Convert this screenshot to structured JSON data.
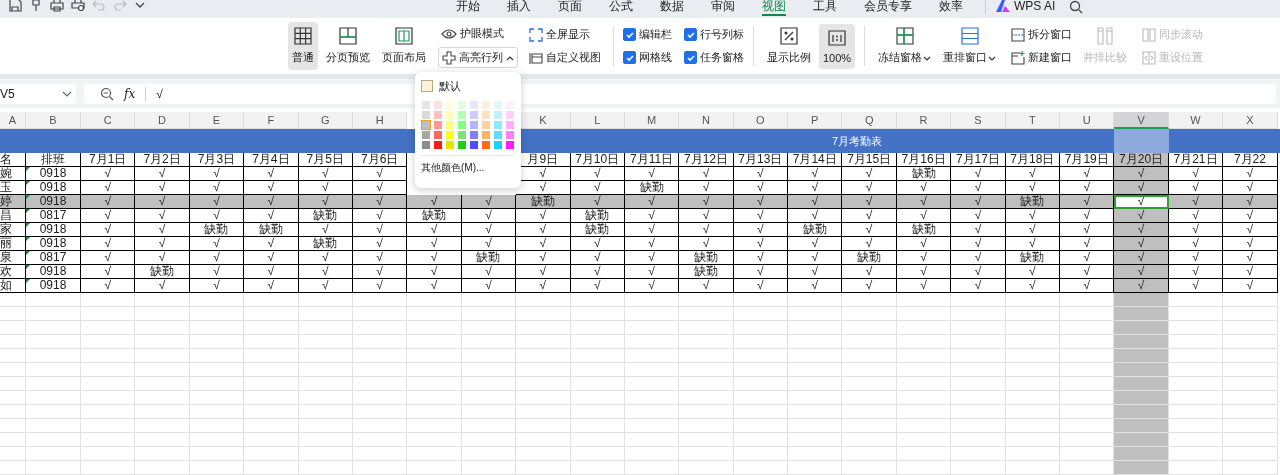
{
  "menu_tabs": [
    {
      "label": "开始",
      "selected": false
    },
    {
      "label": "插入",
      "selected": false
    },
    {
      "label": "页面",
      "selected": false
    },
    {
      "label": "公式",
      "selected": false
    },
    {
      "label": "数据",
      "selected": false
    },
    {
      "label": "审阅",
      "selected": false
    },
    {
      "label": "视图",
      "selected": true
    },
    {
      "label": "工具",
      "selected": false
    },
    {
      "label": "会员专享",
      "selected": false
    },
    {
      "label": "效率",
      "selected": false
    }
  ],
  "ai_button": {
    "label": "WPS AI"
  },
  "ribbon": {
    "view_modes": [
      {
        "label": "普通",
        "kind": "normal",
        "selected": true
      },
      {
        "label": "分页预览",
        "kind": "pagebreak",
        "selected": false
      },
      {
        "label": "页面布局",
        "kind": "layout",
        "selected": false
      }
    ],
    "eye_mode": {
      "label": "护眼模式"
    },
    "highlight": {
      "label": "高亮行列",
      "expanded": true
    },
    "fullscreen": {
      "label": "全屏显示"
    },
    "custom_view": {
      "label": "自定义视图"
    },
    "checks": [
      {
        "label": "编辑栏",
        "checked": true
      },
      {
        "label": "网格线",
        "checked": true
      },
      {
        "label": "行号列标",
        "checked": true
      },
      {
        "label": "任务窗格",
        "checked": true
      }
    ],
    "zoom": {
      "label": "显示比例"
    },
    "zoom100": {
      "label": "100%",
      "selected": true
    },
    "freeze": {
      "label": "冻结窗格"
    },
    "arrange": {
      "label": "重排窗口"
    },
    "split": {
      "label": "拆分窗口"
    },
    "new_window": {
      "label": "新建窗口"
    },
    "compare": {
      "label": "并排比较",
      "disabled": true
    },
    "sync_scroll": {
      "label": "同步滚动",
      "disabled": true
    },
    "reset_pos": {
      "label": "重设位置",
      "disabled": true
    }
  },
  "name_box": "V5",
  "fx": "fx",
  "formula": "√",
  "highlight_menu": {
    "default_label": "默认",
    "more_label": "其他颜色(M)...",
    "swatches": [
      [
        {
          "color": "#e6e6e6",
          "selected": false
        },
        {
          "color": "#ffe0e0",
          "selected": false
        },
        {
          "color": "#ffffe0",
          "selected": false
        },
        {
          "color": "#e0ffe0",
          "selected": false
        },
        {
          "color": "#e6e6ff",
          "selected": false
        },
        {
          "color": "#fff0e0",
          "selected": false
        },
        {
          "color": "#e0f8ff",
          "selected": false
        },
        {
          "color": "#fff0ff",
          "selected": false
        }
      ],
      [
        {
          "color": "#d9d9d9",
          "selected": false
        },
        {
          "color": "#ffbfbf",
          "selected": false
        },
        {
          "color": "#ffffb3",
          "selected": false
        },
        {
          "color": "#b3ffb3",
          "selected": false
        },
        {
          "color": "#ccccff",
          "selected": false
        },
        {
          "color": "#ffe0c0",
          "selected": false
        },
        {
          "color": "#c0f0ff",
          "selected": false
        },
        {
          "color": "#ffd0ff",
          "selected": false
        }
      ],
      [
        {
          "color": "#bfbfbf",
          "selected": true
        },
        {
          "color": "#ff9999",
          "selected": false
        },
        {
          "color": "#ffff80",
          "selected": false
        },
        {
          "color": "#80ff80",
          "selected": false
        },
        {
          "color": "#b3b3ff",
          "selected": false
        },
        {
          "color": "#ffd0a0",
          "selected": false
        },
        {
          "color": "#90e8ff",
          "selected": false
        },
        {
          "color": "#ffb0ff",
          "selected": false
        }
      ],
      [
        {
          "color": "#a6a6a6",
          "selected": false
        },
        {
          "color": "#ff6666",
          "selected": false
        },
        {
          "color": "#ffff1a",
          "selected": false
        },
        {
          "color": "#80e080",
          "selected": false
        },
        {
          "color": "#8080ff",
          "selected": false
        },
        {
          "color": "#ffb366",
          "selected": false
        },
        {
          "color": "#60dcff",
          "selected": false
        },
        {
          "color": "#ff80ff",
          "selected": false
        }
      ],
      [
        {
          "color": "#8c8c8c",
          "selected": false
        },
        {
          "color": "#ff1a1a",
          "selected": false
        },
        {
          "color": "#e6e600",
          "selected": false
        },
        {
          "color": "#1ad11a",
          "selected": false
        },
        {
          "color": "#4d4dff",
          "selected": false
        },
        {
          "color": "#ff6a1a",
          "selected": false
        },
        {
          "color": "#1ad1ff",
          "selected": false
        },
        {
          "color": "#ff1aff",
          "selected": false
        }
      ]
    ]
  },
  "sheet": {
    "title": "7月考勤表",
    "columns": [
      {
        "letter": "A",
        "selected": false
      },
      {
        "letter": "B",
        "selected": false
      },
      {
        "letter": "C",
        "selected": false
      },
      {
        "letter": "D",
        "selected": false
      },
      {
        "letter": "E",
        "selected": false
      },
      {
        "letter": "F",
        "selected": false
      },
      {
        "letter": "G",
        "selected": false
      },
      {
        "letter": "H",
        "selected": false
      },
      {},
      {},
      {
        "letter": "K",
        "selected": false
      },
      {
        "letter": "L",
        "selected": false
      },
      {
        "letter": "M",
        "selected": false
      },
      {
        "letter": "N",
        "selected": false
      },
      {
        "letter": "O",
        "selected": false
      },
      {
        "letter": "P",
        "selected": false
      },
      {
        "letter": "Q",
        "selected": false
      },
      {
        "letter": "R",
        "selected": false
      },
      {
        "letter": "S",
        "selected": false
      },
      {
        "letter": "T",
        "selected": false
      },
      {
        "letter": "U",
        "selected": false
      },
      {
        "letter": "V",
        "selected": true
      },
      {
        "letter": "W",
        "selected": false
      },
      {
        "letter": "X",
        "selected": false
      }
    ],
    "header": [
      "名",
      "排班",
      "7月1日",
      "7月2日",
      "7月3日",
      "7月4日",
      "7月5日",
      "7月6日",
      "月9日",
      "7月10日",
      "7月11日",
      "7月12日",
      "7月13日",
      "7月14日",
      "7月15日",
      "7月16日",
      "7月17日",
      "7月18日",
      "7月19日",
      "7月20日",
      "7月21日",
      "7月22"
    ],
    "rows": [
      {
        "selected": false,
        "cells": [
          "婉",
          "0918",
          "√",
          "√",
          "√",
          "√",
          "√",
          "√",
          "√",
          "√",
          "√",
          "√",
          "√",
          "√",
          "√",
          "缺勤",
          "√",
          "√",
          "√",
          "√",
          "√",
          "√"
        ]
      },
      {
        "selected": false,
        "cells": [
          "玉",
          "0918",
          "√",
          "√",
          "√",
          "√",
          "√",
          "√",
          "√",
          "√",
          "缺勤",
          "√",
          "√",
          "√",
          "√",
          "√",
          "√",
          "√",
          "√",
          "√",
          "√",
          "√"
        ]
      },
      {
        "selected": true,
        "cells": [
          "婷",
          "0918",
          "√",
          "√",
          "√",
          "√",
          "√",
          "√",
          "√",
          "√",
          "缺勤",
          "√",
          "√",
          "√",
          "√",
          "√",
          "√",
          "√",
          "√",
          "缺勤",
          "√",
          "√",
          "√",
          "√"
        ]
      },
      {
        "selected": false,
        "cells": [
          "昌",
          "0817",
          "√",
          "√",
          "√",
          "√",
          "缺勤",
          "√",
          "缺勤",
          "√",
          "√",
          "缺勤",
          "√",
          "√",
          "√",
          "√",
          "√",
          "√",
          "√",
          "√",
          "√",
          "√",
          "√",
          "√"
        ]
      },
      {
        "selected": false,
        "cells": [
          "家",
          "0918",
          "√",
          "√",
          "缺勤",
          "缺勤",
          "√",
          "√",
          "√",
          "√",
          "√",
          "缺勤",
          "√",
          "√",
          "√",
          "缺勤",
          "√",
          "缺勤",
          "√",
          "√",
          "√",
          "√",
          "√",
          "√"
        ]
      },
      {
        "selected": false,
        "cells": [
          "丽",
          "0918",
          "√",
          "√",
          "√",
          "√",
          "缺勤",
          "√",
          "√",
          "√",
          "√",
          "√",
          "√",
          "√",
          "√",
          "√",
          "√",
          "√",
          "√",
          "√",
          "√",
          "√",
          "√",
          "√"
        ]
      },
      {
        "selected": false,
        "cells": [
          "泉",
          "0817",
          "√",
          "√",
          "√",
          "√",
          "√",
          "√",
          "√",
          "缺勤",
          "√",
          "√",
          "√",
          "缺勤",
          "√",
          "√",
          "缺勤",
          "√",
          "√",
          "缺勤",
          "√",
          "√",
          "√",
          "√"
        ]
      },
      {
        "selected": false,
        "cells": [
          "欢",
          "0918",
          "√",
          "缺勤",
          "√",
          "√",
          "√",
          "√",
          "√",
          "√",
          "√",
          "√",
          "√",
          "缺勤",
          "√",
          "√",
          "√",
          "√",
          "√",
          "√",
          "√",
          "√",
          "√",
          "√"
        ]
      },
      {
        "selected": false,
        "cells": [
          "如",
          "0918",
          "√",
          "√",
          "√",
          "√",
          "√",
          "√",
          "√",
          "√",
          "√",
          "√",
          "√",
          "√",
          "√",
          "√",
          "√",
          "√",
          "√",
          "√",
          "√",
          "√",
          "√",
          "√"
        ]
      }
    ]
  }
}
